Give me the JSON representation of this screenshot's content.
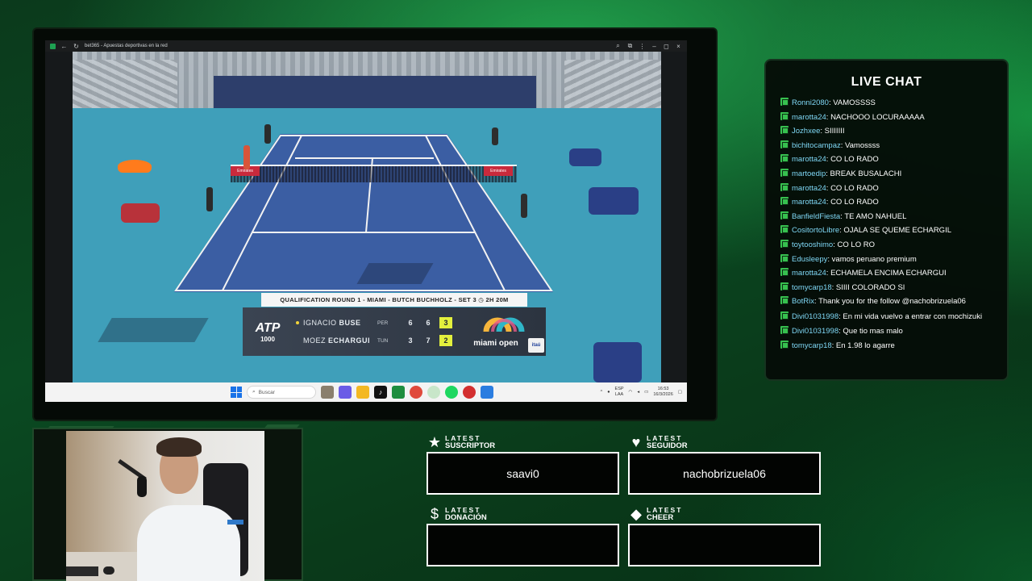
{
  "browser": {
    "tab_title": "bet365 - Apuestas deportivas en la red",
    "controls": {
      "back": "←",
      "reload": "↻",
      "zoom": "⌕",
      "extensions": "⧉",
      "menu": "⋮",
      "minimize": "–",
      "maximize": "◻",
      "close": "×"
    }
  },
  "broadcast": {
    "net_sponsor": "Emirates",
    "round_banner": "QUALIFICATION ROUND 1 - MIAMI - BUTCH BUCHHOLZ - SET 3 ◷ 2H 20M",
    "atp_logo": {
      "main": "ATP",
      "sub": "1000"
    },
    "players": [
      {
        "first": "IGNACIO",
        "last": "BUSE",
        "country": "PER",
        "serving": true,
        "sets": [
          "6",
          "6",
          "3"
        ]
      },
      {
        "first": "MOEZ",
        "last": "ECHARGUI",
        "country": "TUN",
        "serving": false,
        "sets": [
          "3",
          "7",
          "2"
        ]
      }
    ],
    "sponsor": {
      "name": "miami open",
      "badge": "itaú"
    }
  },
  "taskbar": {
    "search_placeholder": "Buscar",
    "lang_top": "ESP",
    "lang_bottom": "LAA",
    "time": "16:53",
    "date": "16/3/2026",
    "tray_up": "^"
  },
  "chat": {
    "title": "LIVE CHAT",
    "messages": [
      {
        "user": "Ronni2080",
        "text": "VAMOSSSS"
      },
      {
        "user": "marotta24",
        "text": "NACHOOO LOCURAAAAA"
      },
      {
        "user": "Jozhxee",
        "text": "SIIIIIII"
      },
      {
        "user": "bichitocampaz",
        "text": "Vamossss"
      },
      {
        "user": "marotta24",
        "text": "CO LO RADO"
      },
      {
        "user": "martoedip",
        "text": "BREAK BUSALACHI"
      },
      {
        "user": "marotta24",
        "text": "CO LO RADO"
      },
      {
        "user": "marotta24",
        "text": "CO LO RADO"
      },
      {
        "user": "BanfieldFiesta",
        "text": "TE AMO NAHUEL"
      },
      {
        "user": "CositortoLibre",
        "text": "OJALA SE QUEME ECHARGIL"
      },
      {
        "user": "toytooshimo",
        "text": "CO LO RO"
      },
      {
        "user": "Edusleepy",
        "text": "vamos peruano premium"
      },
      {
        "user": "marotta24",
        "text": "ECHAMELA ENCIMA ECHARGUI"
      },
      {
        "user": "tomycarp18",
        "text": "SIIII COLORADO SI"
      },
      {
        "user": "BotRix",
        "text": "Thank you for the follow @nachobrizuela06"
      },
      {
        "user": "Divi01031998",
        "text": "En mi vida vuelvo a entrar con mochizuki"
      },
      {
        "user": "Divi01031998",
        "text": "Que tio mas malo"
      },
      {
        "user": "tomycarp18",
        "text": "En 1.98 lo agarre"
      }
    ]
  },
  "alerts": {
    "latest_word": "LATEST",
    "subscriber": {
      "type": "SUSCRIPTOR",
      "icon": "star-icon",
      "value": "saavi0"
    },
    "follower": {
      "type": "SEGUIDOR",
      "icon": "heart-icon",
      "value": "nachobrizuela06"
    },
    "donation": {
      "type": "DONACIÓN",
      "icon": "dollar-icon",
      "value": ""
    },
    "cheer": {
      "type": "CHEER",
      "icon": "diamond-icon",
      "value": ""
    }
  },
  "colors": {
    "chat_username": "#7fd7f5",
    "chat_badge": "#37c04f",
    "score_highlight": "#e3f03d",
    "background_green": "#0a4a22"
  }
}
